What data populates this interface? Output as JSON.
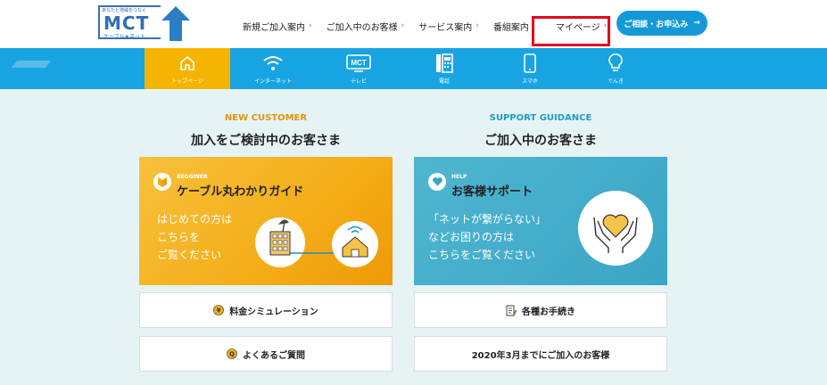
{
  "logo": {
    "tagline": "あなたと地域をつなぐ",
    "name": "MCT",
    "sub": "ケーブル★ネット"
  },
  "topnav": {
    "items": [
      {
        "label": "新規ご加入案内"
      },
      {
        "label": "ご加入中のお客様"
      },
      {
        "label": "サービス案内"
      },
      {
        "label": "番組案内"
      },
      {
        "label": "マイページ"
      }
    ],
    "cta": "ご相談・お申込み"
  },
  "mainnav": {
    "items": [
      {
        "label": "トップページ",
        "icon": "home-icon"
      },
      {
        "label": "インターネット",
        "icon": "wifi-icon"
      },
      {
        "label": "テレビ",
        "icon": "tv-icon"
      },
      {
        "label": "電話",
        "icon": "phone-icon"
      },
      {
        "label": "スマホ",
        "icon": "smartphone-icon"
      },
      {
        "label": "でんき",
        "icon": "bulb-icon"
      }
    ]
  },
  "new_customer": {
    "en": "NEW CUSTOMER",
    "jp": "加入をご検討中のお客さま",
    "card": {
      "kicker": "BEGGINER",
      "title": "ケーブル丸わかりガイド",
      "desc": [
        "はじめての方は",
        "こちらを",
        "ご覧ください"
      ]
    },
    "buttons": [
      "料金シミュレーション",
      "よくあるご質問"
    ]
  },
  "support": {
    "en": "SUPPORT GUIDANCE",
    "jp": "ご加入中のお客さま",
    "card": {
      "kicker": "HELP",
      "title": "お客様サポート",
      "desc": [
        "「ネットが繋がらない」",
        "などお困りの方は",
        "こちらをご覧ください"
      ]
    },
    "buttons": [
      "各種お手続き",
      "2020年3月までにご加入のお客様"
    ]
  },
  "colors": {
    "accent_blue": "#18a4e2",
    "accent_orange": "#f5b400",
    "en_orange": "#e0960a",
    "en_blue": "#1e9cc8",
    "highlight_red": "#e3001b"
  }
}
